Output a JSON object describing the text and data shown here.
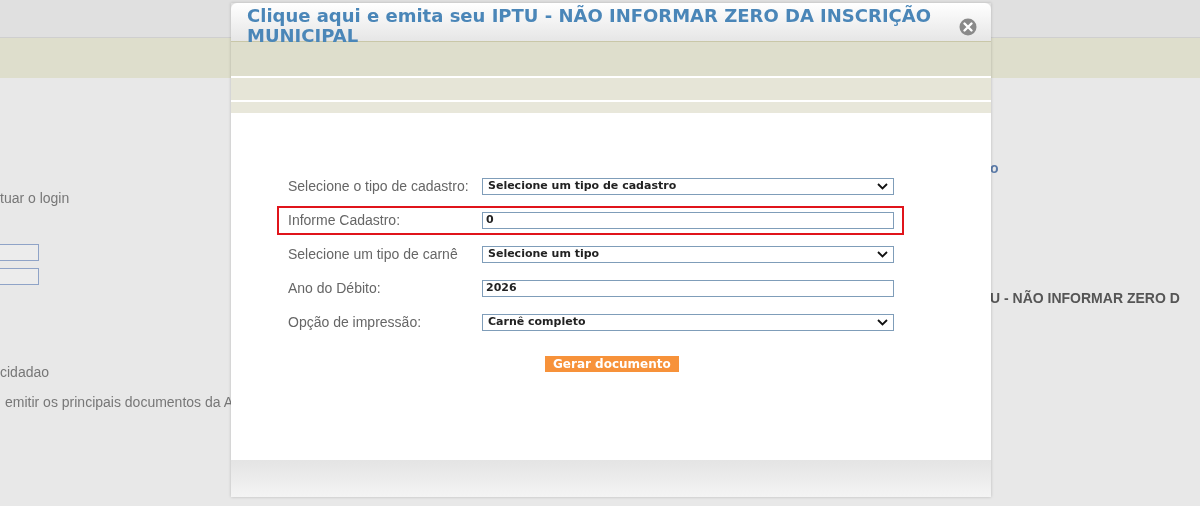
{
  "background": {
    "login_hint": "tuar o login",
    "section_title": "cidadao",
    "section_text": "emitir os principais documentos da A",
    "right_link": "o",
    "right_heading": "U - NÃO INFORMAR ZERO D"
  },
  "modal": {
    "title": "Clique aqui e emita seu IPTU - NÃO INFORMAR ZERO DA INSCRIÇÃO MUNICIPAL",
    "fields": [
      {
        "kind": "select",
        "label": "Selecione o tipo de cadastro:",
        "value": "Selecione um tipo de cadastro",
        "highlighted": false
      },
      {
        "kind": "input",
        "label": "Informe Cadastro:",
        "value": "0",
        "highlighted": true
      },
      {
        "kind": "select",
        "label": "Selecione um tipo de carnê",
        "value": "Selecione um tipo",
        "highlighted": false
      },
      {
        "kind": "input",
        "label": "Ano do Débito:",
        "value": "2026",
        "highlighted": false
      },
      {
        "kind": "select",
        "label": "Opção de impressão:",
        "value": "Carnê completo",
        "highlighted": false
      }
    ],
    "button": "Gerar documento"
  }
}
